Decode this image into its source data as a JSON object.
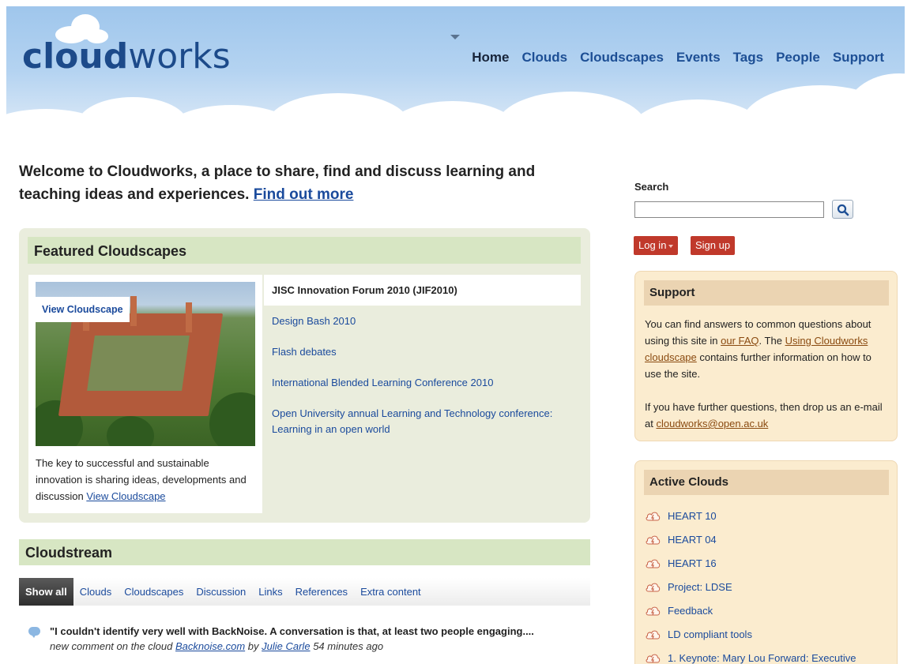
{
  "header": {
    "logo_bold": "cloud",
    "logo_light": "works",
    "nav": [
      {
        "label": "Home",
        "active": true
      },
      {
        "label": "Clouds"
      },
      {
        "label": "Cloudscapes"
      },
      {
        "label": "Events"
      },
      {
        "label": "Tags"
      },
      {
        "label": "People"
      },
      {
        "label": "Support"
      }
    ]
  },
  "intro": {
    "text": "Welcome to Cloudworks, a place to share, find and discuss learning and teaching ideas and experiences.",
    "link": "Find out more"
  },
  "featured": {
    "heading": "Featured Cloudscapes",
    "badge": "View Cloudscape",
    "caption": "The key to successful and sustainable innovation is sharing ideas, developments and discussion",
    "caption_link": "View Cloudscape",
    "items": [
      "JISC Innovation Forum 2010 (JIF2010)",
      "Design Bash 2010",
      "Flash debates",
      "International Blended Learning Conference 2010",
      "Open University annual Learning and Technology conference: Learning in an open world"
    ]
  },
  "cloudstream": {
    "heading": "Cloudstream",
    "tabs": [
      "Show all",
      "Clouds",
      "Cloudscapes",
      "Discussion",
      "Links",
      "References",
      "Extra content"
    ],
    "item": {
      "title": "\"I couldn't identify very well with BackNoise. A conversation is that, at least two people engaging....",
      "meta_prefix": "new comment on the cloud",
      "cloud_link": "Backnoise.com",
      "by": "by",
      "author": "Julie Carle",
      "time": "54 minutes ago"
    }
  },
  "sidebar": {
    "search_label": "Search",
    "search_value": "",
    "login": "Log in",
    "signup": "Sign up",
    "support": {
      "heading": "Support",
      "p1_a": "You can find answers to common questions about using this site in",
      "p1_link1": "our FAQ",
      "p1_b": ". The",
      "p1_link2": "Using Cloudworks cloudscape",
      "p1_c": "contains further information on how to use the site.",
      "p2_a": "If you have further questions, then drop us an e-mail at",
      "p2_link": "cloudworks@open.ac.uk"
    },
    "active_clouds": {
      "heading": "Active Clouds",
      "items": [
        "HEART 10",
        "HEART 04",
        "HEART 16",
        "Project: LDSE",
        "Feedback",
        "LD compliant tools",
        "1. Keynote: Mary Lou Forward: Executive"
      ]
    }
  },
  "colors": {
    "brand_blue": "#1c4a8a",
    "green_panel": "#d7e6c3",
    "tan_panel": "#fbeccf",
    "button_red": "#c0392b"
  }
}
